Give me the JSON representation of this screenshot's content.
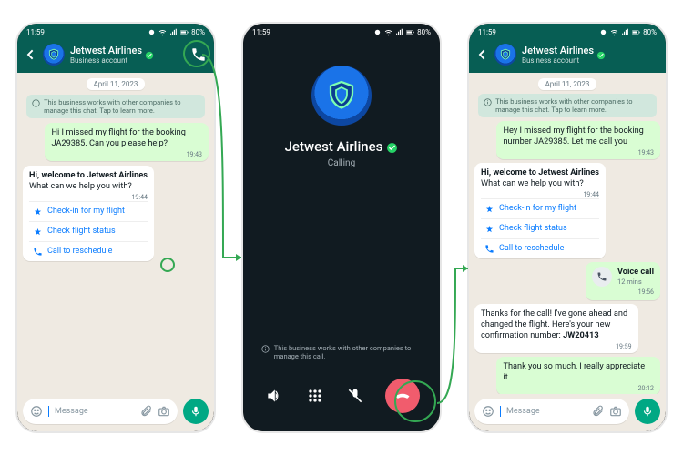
{
  "status": {
    "time": "11:59",
    "battery": "80%"
  },
  "header": {
    "title": "Jetwest Airlines",
    "subtitle": "Business account"
  },
  "chat_left": {
    "date": "April 11, 2023",
    "system_notice": "This business works with other companies to manage this chat. Tap to learn more.",
    "out1": {
      "text": "Hi I missed my flight for the booking JA29385. Can you please help?",
      "time": "19:43"
    },
    "menu": {
      "heading": "Hi, welcome to Jetwest Airlines",
      "sub": "What can we help you with?",
      "time": "19:44",
      "opt1": "Check-in for my flight",
      "opt2": "Check flight status",
      "opt3": "Call to reschedule"
    }
  },
  "chat_right": {
    "date": "April 11, 2023",
    "system_notice": "This business works with other companies to manage this chat. Tap to learn more.",
    "out1": {
      "text": "Hey I missed my flight for the booking number JA29385. Let me call you",
      "time": "19:43"
    },
    "menu": {
      "heading": "Hi, welcome to Jetwest Airlines",
      "sub": "What can we help you with?",
      "time": "19:44",
      "opt1": "Check-in for my flight",
      "opt2": "Check flight status",
      "opt3": "Call to reschedule"
    },
    "voice_call": {
      "label": "Voice call",
      "duration": "12 mins",
      "time": "19:56"
    },
    "in2": {
      "prefix": "Thanks for the call! I've gone ahead and changed the flight. Here's your new confirmation number: ",
      "code": "JW20413",
      "time": "19:59"
    },
    "out2": {
      "text": "Thank you so much, I really appreciate it.",
      "time": "20:12"
    }
  },
  "calling": {
    "name": "Jetwest Airlines",
    "status": "Calling",
    "system_notice": "This business works with other companies to manage this call."
  },
  "input": {
    "placeholder": "Message"
  }
}
